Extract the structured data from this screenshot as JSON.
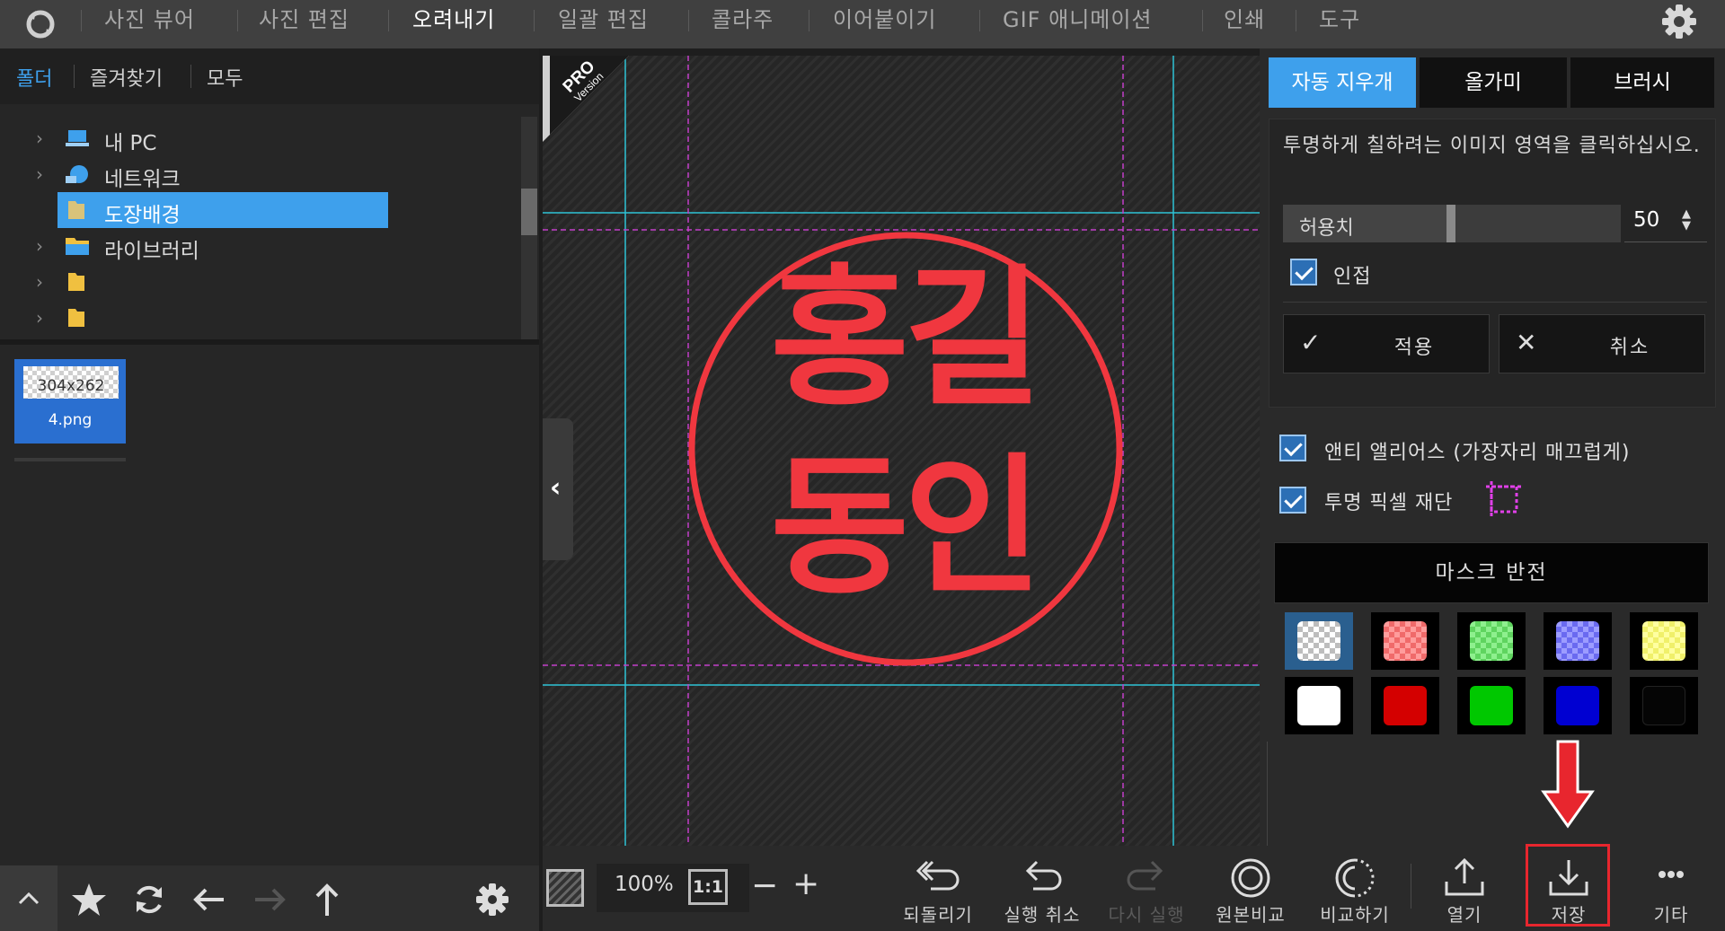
{
  "nav": {
    "items": [
      "사진 뷰어",
      "사진 편집",
      "오려내기",
      "일괄 편집",
      "콜라주",
      "이어붙이기",
      "GIF 애니메이션",
      "인쇄",
      "도구"
    ],
    "active_index": 2
  },
  "left_tabs": [
    "폴더",
    "즐겨찾기",
    "모두"
  ],
  "tree": [
    {
      "label": "내 PC",
      "icon": "pc-icon"
    },
    {
      "label": "네트워크",
      "icon": "network-icon"
    },
    {
      "label": "도장배경",
      "icon": "folder-icon",
      "selected": true
    },
    {
      "label": "라이브러리",
      "icon": "library-icon"
    },
    {
      "label": "",
      "icon": "folder-icon"
    },
    {
      "label": "",
      "icon": "folder-icon"
    }
  ],
  "thumbnail": {
    "dimensions": "304x262",
    "name": "4.png"
  },
  "pro_badge": {
    "line1": "PRO",
    "line2": "Version"
  },
  "stamp": {
    "line1": "홍길",
    "line2": "동인",
    "color": "#f0373f"
  },
  "right_tabs": [
    "자동 지우개",
    "올가미",
    "브러시"
  ],
  "hint": "투명하게 칠하려는 이미지 영역을 클릭하십시오.",
  "tolerance": {
    "label": "허용치",
    "value": "50",
    "level_fraction": 0.5
  },
  "adjacent_label": "인접",
  "apply_label": "적용",
  "cancel_label": "취소",
  "antialias_label": "앤티 앨리어스 (가장자리 매끄럽게)",
  "trim_label": "투명 픽셀 재단",
  "mask_invert_label": "마스크 반전",
  "swatches_row1": [
    "#bdbdbd",
    "#f06a6a",
    "#5fd45f",
    "#6a6af0",
    "#f0f06a"
  ],
  "swatches_row2": [
    "#ffffff",
    "#d40000",
    "#00c800",
    "#0000d2",
    "#050505"
  ],
  "zoom": {
    "value": "100%",
    "one_to_one": "1:1",
    "minus": "−",
    "plus": "+"
  },
  "toolbar": {
    "revert": "되돌리기",
    "undo": "실행 취소",
    "redo": "다시 실행",
    "original": "원본비교",
    "compare": "비교하기",
    "open": "열기",
    "save": "저장",
    "more": "기타"
  },
  "colors": {
    "accent": "#3ea0ec",
    "highlight": "#e8262e"
  }
}
